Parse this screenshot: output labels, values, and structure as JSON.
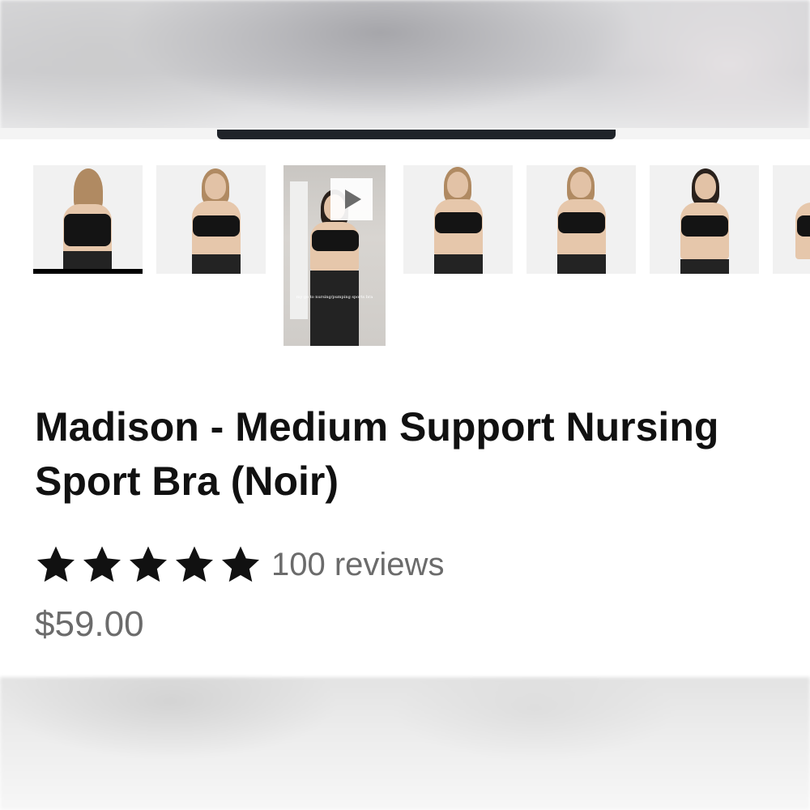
{
  "product": {
    "title": "Madison - Medium Support Nursing Sport Bra (Noir)",
    "rating": {
      "stars": 5,
      "max_stars": 5,
      "reviews_label": "100 reviews"
    },
    "price": "$59.00"
  },
  "gallery": {
    "active_index": 0,
    "thumbnails": [
      {
        "kind": "image",
        "view": "back"
      },
      {
        "kind": "image",
        "view": "front-nursing-clip"
      },
      {
        "kind": "video",
        "icon": "play-icon",
        "caption": "my go to nursing/pumping sports bra"
      },
      {
        "kind": "image",
        "view": "front"
      },
      {
        "kind": "image",
        "view": "front-smile"
      },
      {
        "kind": "image",
        "view": "front-alt-model"
      },
      {
        "kind": "image",
        "view": "partial"
      }
    ]
  },
  "colors": {
    "text_primary": "#111111",
    "text_muted": "#6b6b6b",
    "star": "#111111",
    "active_indicator": "#000000"
  }
}
